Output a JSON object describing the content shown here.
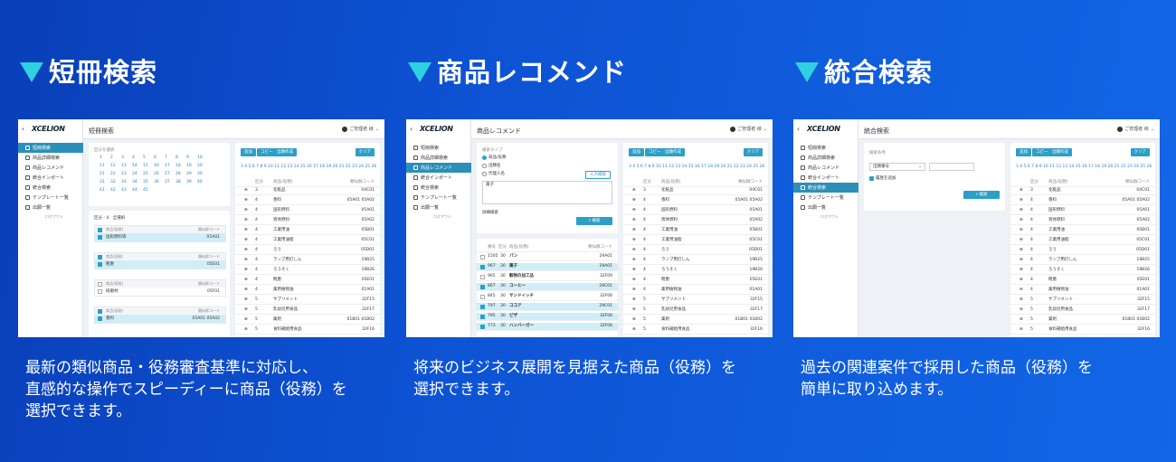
{
  "sections": [
    {
      "heading": "短冊検索",
      "description_lines": [
        "最新の類似商品・役務審査基準に対応し、",
        "直感的な操作でスピーディーに商品（役務）を",
        "選択できます。"
      ],
      "screenshot": {
        "page_title": "短冊検索",
        "user_label": "ご管理者 様",
        "nav_active": 0
      }
    },
    {
      "heading": "商品レコメンド",
      "description_lines": [
        "将来のビジネス展開を見据えた商品（役務）を",
        "選択できます。"
      ],
      "screenshot": {
        "page_title": "商品レコメンド",
        "user_label": "ご管理者 様",
        "nav_active": 2
      }
    },
    {
      "heading": "統合検索",
      "description_lines": [
        "過去の関連案件で採用した商品（役務）を",
        "簡単に取り込めます。"
      ],
      "screenshot": {
        "page_title": "統合検索",
        "user_label": "ご管理者 様",
        "nav_active": 4
      }
    }
  ],
  "app": {
    "logo": "XCELION",
    "nav_items": [
      "短冊検索",
      "商品詳細検索",
      "商品レコメンド",
      "統合インポート",
      "統合検索",
      "テンプレート一覧",
      "出願一覧"
    ],
    "nav_footer": "ログアウト",
    "toolbar_buttons": [
      "追加",
      "コピー",
      "出願作成",
      "クリア"
    ],
    "result_headers": [
      "区分",
      "商品(役務)",
      "類似群コード"
    ],
    "results": [
      {
        "cls": "3",
        "name": "化粧品",
        "code": "04C01"
      },
      {
        "cls": "4",
        "name": "香料",
        "code": "05A01 05A02"
      },
      {
        "cls": "4",
        "name": "固形燃料",
        "code": "05A01"
      },
      {
        "cls": "4",
        "name": "液体燃料",
        "code": "05A02"
      },
      {
        "cls": "4",
        "name": "工業用油",
        "code": "05B01"
      },
      {
        "cls": "4",
        "name": "工業用油脂",
        "code": "05C01"
      },
      {
        "cls": "4",
        "name": "ろう",
        "code": "05D01"
      },
      {
        "cls": "4",
        "name": "ランプ用灯しん",
        "code": "19B25"
      },
      {
        "cls": "4",
        "name": "ろうそく",
        "code": "19B26"
      },
      {
        "cls": "4",
        "name": "靴墨",
        "code": "05E01"
      },
      {
        "cls": "4",
        "name": "薬用植物油",
        "code": "01A01"
      },
      {
        "cls": "5",
        "name": "サプリメント",
        "code": "32F15"
      },
      {
        "cls": "5",
        "name": "乳幼児用食品",
        "code": "32F17"
      },
      {
        "cls": "5",
        "name": "薬剤",
        "code": "01B01 01B02"
      },
      {
        "cls": "5",
        "name": "食料補給用食品",
        "code": "32F16"
      }
    ],
    "class_numbers": [
      "1",
      "2",
      "3",
      "4",
      "5",
      "6",
      "7",
      "8",
      "9",
      "10",
      "11",
      "12",
      "13",
      "14",
      "15",
      "16",
      "17",
      "18",
      "19",
      "20",
      "21",
      "22",
      "23",
      "24",
      "25",
      "26",
      "27",
      "28",
      "29",
      "30",
      "31",
      "32",
      "33",
      "34",
      "35",
      "36",
      "37",
      "38",
      "39",
      "40",
      "41",
      "42",
      "43",
      "44",
      "45"
    ],
    "short_search": {
      "class_label": "区分を選択",
      "count_label": "区分 : 4　全選択",
      "cards": [
        {
          "head": "商品(役務)",
          "code_head": "類似群コード",
          "item": "固形燃料等",
          "code": "05A01",
          "hl": true
        },
        {
          "head": "商品(役務)",
          "code_head": "類似群コード",
          "item": "靴墨",
          "code": "05E01",
          "hl": true
        },
        {
          "head": "商品(役務)",
          "code_head": "類似群コード",
          "item": "研磨材",
          "code": "05F01",
          "hl": false
        },
        {
          "head": "商品(役務)",
          "code_head": "類似群コード",
          "item": "香料",
          "code": "05A01 05A02",
          "hl": true
        }
      ]
    },
    "recommend": {
      "type_label": "検索タイプ",
      "radios": [
        "商品/役務",
        "出願名",
        "代理人名"
      ],
      "input_button": "入力補助",
      "textarea": "菓子",
      "detail": "詳細検索",
      "search_button": "検索",
      "table_headers": [
        "番号",
        "区分",
        "商品(役務)",
        "類似群コード"
      ],
      "rows": [
        {
          "no": "1505",
          "cls": "30",
          "name": "パン",
          "code": "29A01",
          "hl": false
        },
        {
          "no": "967",
          "cls": "30",
          "name": "菓子",
          "code": "29A01",
          "hl": true
        },
        {
          "no": "965",
          "cls": "30",
          "name": "穀物の加工品",
          "code": "32F09",
          "hl": false
        },
        {
          "no": "867",
          "cls": "30",
          "name": "コーヒー",
          "code": "29C01",
          "hl": true
        },
        {
          "no": "845",
          "cls": "30",
          "name": "サンドイッチ",
          "code": "32F06",
          "hl": false
        },
        {
          "no": "797",
          "cls": "30",
          "name": "ココア",
          "code": "29C01",
          "hl": true
        },
        {
          "no": "795",
          "cls": "30",
          "name": "ピザ",
          "code": "32F06",
          "hl": true
        },
        {
          "no": "773",
          "cls": "30",
          "name": "ハンバーガー",
          "code": "32F06",
          "hl": true
        }
      ]
    },
    "integrated": {
      "cond_label": "検索条件",
      "select_value": "出願番号",
      "checkbox": "履歴を追加",
      "search_button": "検索"
    }
  }
}
